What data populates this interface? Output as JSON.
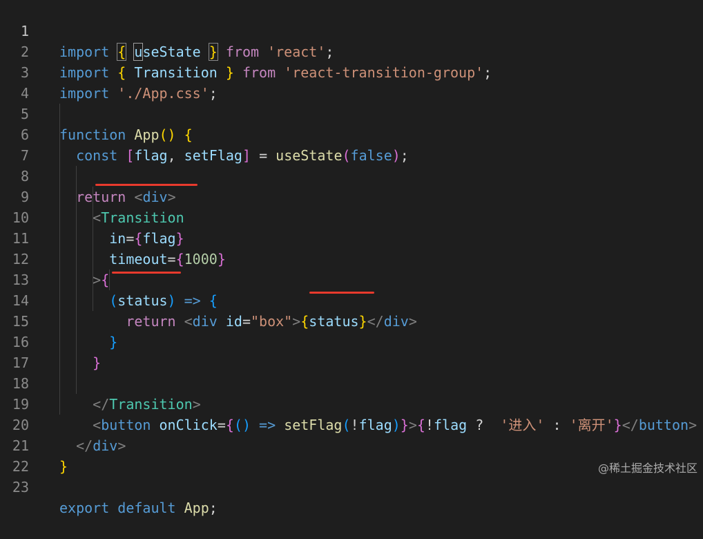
{
  "editor": {
    "line_numbers": [
      "1",
      "2",
      "3",
      "4",
      "5",
      "6",
      "7",
      "8",
      "9",
      "10",
      "11",
      "12",
      "13",
      "14",
      "15",
      "16",
      "17",
      "18",
      "19",
      "20",
      "21",
      "22",
      "23"
    ],
    "lines": [
      "import { useState } from 'react';",
      "import { Transition } from 'react-transition-group';",
      "import './App.css';",
      "",
      "function App() {",
      "  const [flag, setFlag] = useState(false);",
      "",
      "  return <div>",
      "    <Transition",
      "      in={flag}",
      "      timeout={1000}",
      "    >{",
      "      (status) => {",
      "        return <div id=\"box\">{status}</div>",
      "      }",
      "    }",
      "",
      "    </Transition>",
      "    <button onClick={() => setFlag(!flag)}>{!flag ?  '进入' : '离开'}</button>",
      "  </div>",
      "}",
      "",
      "export default App;"
    ]
  },
  "watermark": "@稀土掘金技术社区",
  "colors": {
    "background": "#1e1e1e",
    "highlight_underline": "#e83a2d"
  }
}
